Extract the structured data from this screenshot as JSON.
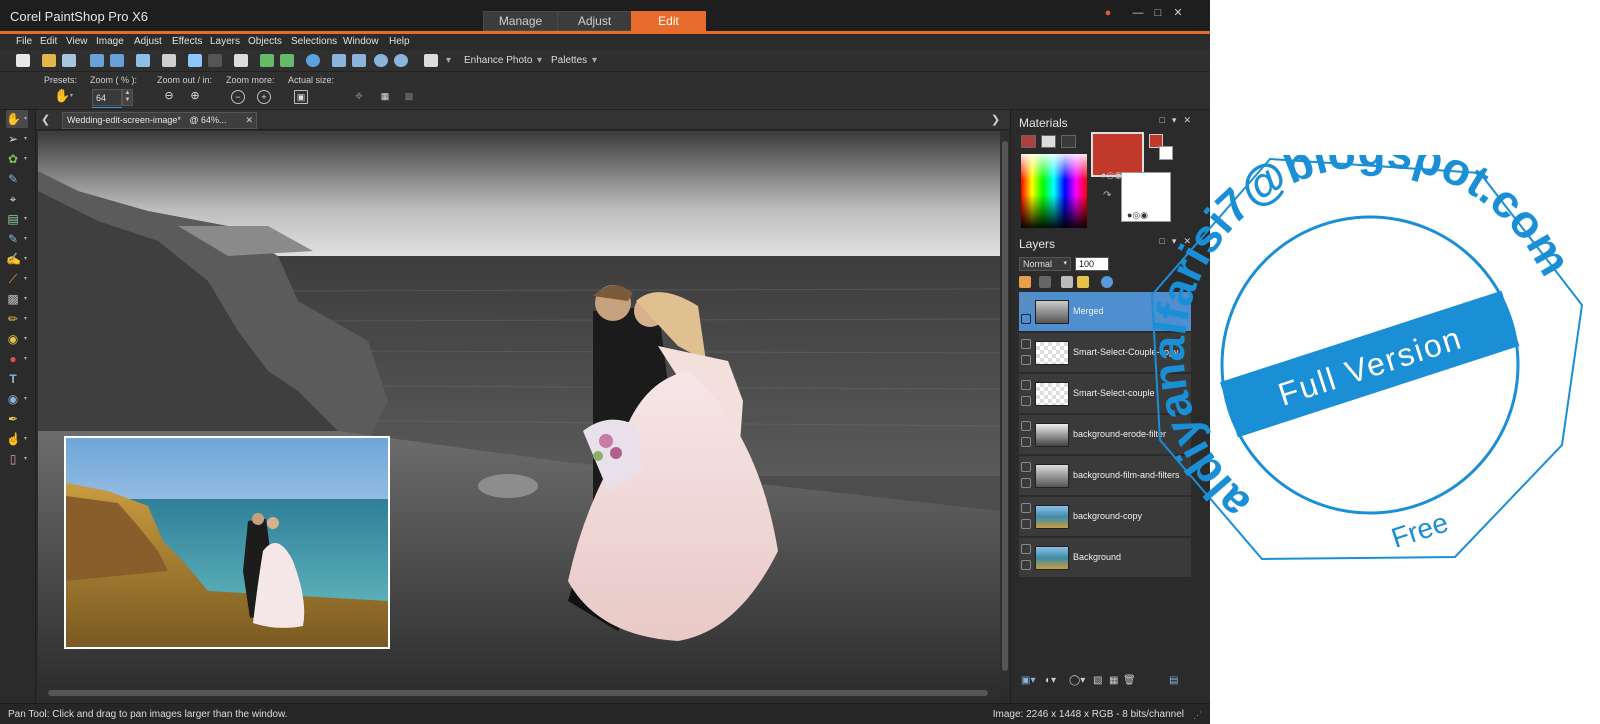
{
  "app": {
    "title": "Corel PaintShop Pro X6",
    "workspace_tabs": [
      "Manage",
      "Adjust",
      "Edit"
    ],
    "active_tab": "Edit",
    "accent_color": "#e76b2a"
  },
  "window_controls": [
    "user-icon",
    "minimize-icon",
    "maximize-icon",
    "close-icon"
  ],
  "menu": [
    "File",
    "Edit",
    "View",
    "Image",
    "Adjust",
    "Effects",
    "Layers",
    "Objects",
    "Selections",
    "Window",
    "Help"
  ],
  "toolbar": {
    "enhance_photo": "Enhance Photo",
    "palettes": "Palettes"
  },
  "tool_options": {
    "presets_label": "Presets:",
    "zoom_label": "Zoom ( % ):",
    "zoom_value": "64",
    "zoom_out_in_label": "Zoom out / in:",
    "zoom_more_label": "Zoom more:",
    "actual_size_label": "Actual size:"
  },
  "tools": [
    "pan-icon",
    "pick-icon",
    "selection-icon",
    "dropper-icon",
    "crop-icon",
    "straighten-icon",
    "makeover-icon",
    "clone-icon",
    "line-icon",
    "gradient-icon",
    "paintbrush-icon",
    "dodge-icon",
    "color-replacer-icon",
    "text-icon",
    "shape-icon",
    "pen-icon",
    "smudge-icon",
    "eraser-icon"
  ],
  "document": {
    "tab_title": "Wedding-edit-screen-image*",
    "tab_zoom": "@ 64%..."
  },
  "materials": {
    "title": "Materials",
    "foreground_color": "#c0392b",
    "background_color": "#ffffff"
  },
  "layers": {
    "title": "Layers",
    "blend_mode": "Normal",
    "opacity": "100",
    "items": [
      {
        "name": "Merged",
        "selected": true
      },
      {
        "name": "Smart-Select-Couple-copy",
        "selected": false
      },
      {
        "name": "Smart-Select-couple",
        "selected": false
      },
      {
        "name": "background-erode-filter",
        "selected": false
      },
      {
        "name": "background-film-and-filters",
        "selected": false
      },
      {
        "name": "background-copy",
        "selected": false
      },
      {
        "name": "Background",
        "selected": false
      }
    ]
  },
  "status": {
    "left": "Pan Tool: Click and drag to pan images larger than the window.",
    "right": "Image:  2246 x 1448 x RGB - 8 bits/channel"
  },
  "watermark": {
    "top_text": "aldiyanalfarisi7@blogspot.com",
    "banner": "Full Version",
    "bottom": "Free",
    "color": "#1a8fd6"
  }
}
